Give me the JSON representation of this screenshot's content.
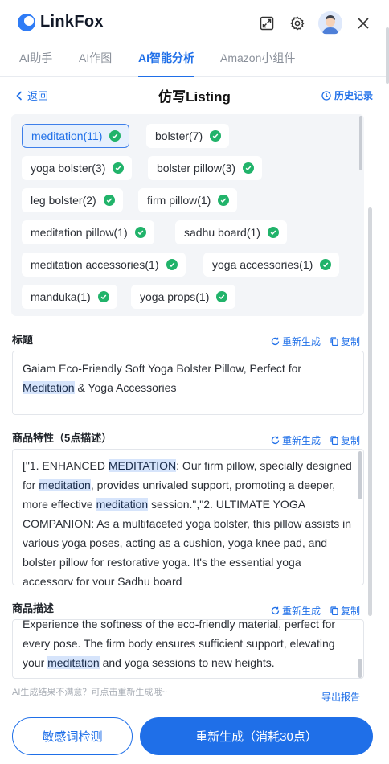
{
  "app": {
    "logo_text": "LinkFox"
  },
  "header_icons": [
    "expand-icon",
    "gear-icon",
    "avatar",
    "close-icon"
  ],
  "tabs": [
    {
      "label": "AI助手",
      "active": false
    },
    {
      "label": "AI作图",
      "active": false
    },
    {
      "label": "AI智能分析",
      "active": true
    },
    {
      "label": "Amazon小组件",
      "active": false
    }
  ],
  "subheader": {
    "back": "返回",
    "title": "仿写Listing",
    "history": "历史记录"
  },
  "keywords": [
    {
      "label": "meditation(11)",
      "selected": true
    },
    {
      "label": "bolster(7)",
      "selected": false
    },
    {
      "label": "yoga bolster(3)",
      "selected": false
    },
    {
      "label": "bolster pillow(3)",
      "selected": false
    },
    {
      "label": "leg bolster(2)",
      "selected": false
    },
    {
      "label": "firm pillow(1)",
      "selected": false
    },
    {
      "label": "meditation pillow(1)",
      "selected": false
    },
    {
      "label": "sadhu board(1)",
      "selected": false
    },
    {
      "label": "meditation accessories(1)",
      "selected": false
    },
    {
      "label": "yoga accessories(1)",
      "selected": false
    },
    {
      "label": "manduka(1)",
      "selected": false
    },
    {
      "label": "yoga props(1)",
      "selected": false
    }
  ],
  "actions": {
    "regenerate": "重新生成",
    "copy": "复制"
  },
  "title_section": {
    "label": "标题",
    "text": "Gaiam Eco-Friendly Soft Yoga Bolster Pillow, Perfect for Meditation & Yoga Accessories"
  },
  "features_section": {
    "label": "商品特性（5点描述）",
    "text": "[\"1. ENHANCED MEDITATION: Our firm pillow, specially designed for meditation, provides unrivaled support, promoting a deeper, more effective meditation session.\",\"2. ULTIMATE YOGA COMPANION: As a multifaceted yoga bolster, this pillow assists in various yoga poses, acting as a cushion, yoga knee pad, and bolster pillow for restorative yoga. It's the essential yoga accessory for your Sadhu board"
  },
  "description_section": {
    "label": "商品描述",
    "text": "Experience the softness of the eco-friendly material, perfect for every pose. The firm body ensures sufficient support, elevating your meditation and yoga sessions to new heights."
  },
  "footer": {
    "hint": "AI生成结果不满意？可点击重新生成哦~",
    "export": "导出报告",
    "sensitive_button": "敏感词检测",
    "regenerate_button": "重新生成（消耗30点）"
  },
  "colors": {
    "accent": "#1f6fe8",
    "check": "#21b36a",
    "highlight": "#d6e4fb"
  }
}
